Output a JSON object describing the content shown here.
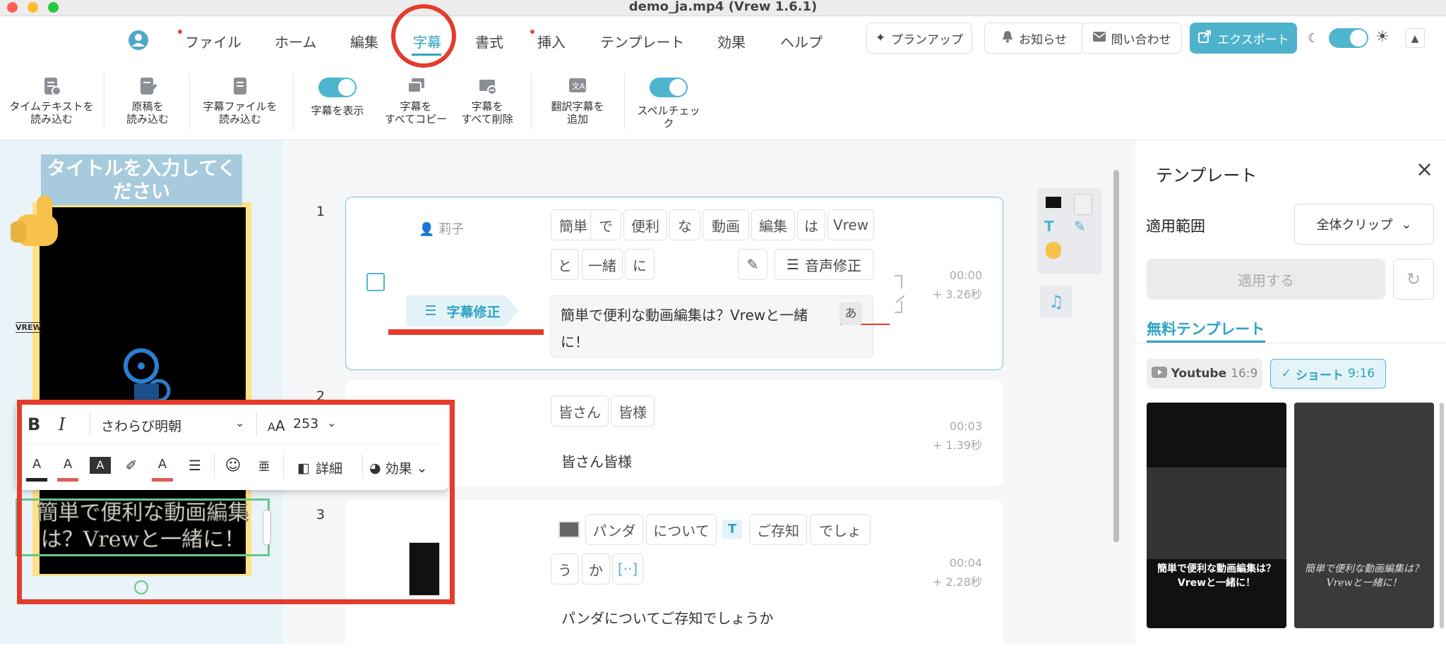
{
  "window": {
    "title": "demo_ja.mp4 (Vrew 1.6.1)"
  },
  "menu": {
    "items": [
      "ファイル",
      "ホーム",
      "編集",
      "字幕",
      "書式",
      "挿入",
      "テンプレート",
      "効果",
      "ヘルプ"
    ],
    "active": "字幕"
  },
  "header_buttons": {
    "planup": "プランアップ",
    "notice": "お知らせ",
    "contact": "問い合わせ",
    "export": "エクスポート"
  },
  "ribbon": {
    "timetext": [
      "タイムテキストを",
      "読み込む"
    ],
    "script": [
      "原稿を",
      "読み込む"
    ],
    "subfile": [
      "字幕ファイルを",
      "読み込む"
    ],
    "show": "字幕を表示",
    "copyall": [
      "字幕を",
      "すべてコピー"
    ],
    "deleteall": [
      "字幕を",
      "すべて削除"
    ],
    "translate": [
      "翻訳字幕を",
      "追加"
    ],
    "spell": [
      "スペルチェッ",
      "ク"
    ]
  },
  "preview": {
    "title_text": [
      "タイトルを入力してく",
      "ださい"
    ],
    "caption": [
      "簡単で便利な動画編集",
      "は？Vrewと一緒に！"
    ]
  },
  "format_popup": {
    "font": "さわらび明朝",
    "size": "253",
    "detail": "詳細",
    "effect": "効果"
  },
  "clips": [
    {
      "index": "1",
      "speaker": "莉子",
      "words_row1": [
        "簡単",
        "で",
        "便利",
        "な",
        "動画",
        "編集",
        "は",
        "Vrew"
      ],
      "words_row2": [
        "と",
        "一緒",
        "に"
      ],
      "fix_voice": "音声修正",
      "fix_sub": "字幕修正",
      "subtitle": [
        "簡単で便利な動画編集は？Vrewと一緒",
        "に！"
      ],
      "kana_badge": "あ",
      "time": "00:00",
      "duration": "+ 3.26秒"
    },
    {
      "index": "2",
      "words_row1": [
        "皆さん",
        "皆様"
      ],
      "subtitle": [
        "皆さん皆様"
      ],
      "time": "00:03",
      "duration": "+ 1.39秒"
    },
    {
      "index": "3",
      "words_row1": [
        "パンダ",
        "について",
        "ご存知",
        "でしょ"
      ],
      "words_row2": [
        "う",
        "か",
        "[··]"
      ],
      "subtitle": [
        "パンダについてご存知でしょうか"
      ],
      "time": "00:04",
      "duration": "+ 2.28秒"
    }
  ],
  "template_panel": {
    "title": "テンプレート",
    "scope_label": "適用範囲",
    "scope_value": "全体クリップ",
    "apply_button": "適用する",
    "free_tab": "無料テンプレート",
    "filter_youtube": "Youtube",
    "filter_youtube_ratio": "16:9",
    "filter_short": "ショート",
    "filter_short_ratio": "9:16",
    "thumb1_caption": [
      "簡単で便利な動画編集は？",
      "Vrewと一緒に！"
    ],
    "thumb2_caption": [
      "簡単で便利な動画編集は？",
      "Vrewと一緒に！"
    ]
  },
  "colors": {
    "accent": "#4fb5cf",
    "highlight": "#e53b2c",
    "export_bg": "#4db3cd"
  }
}
